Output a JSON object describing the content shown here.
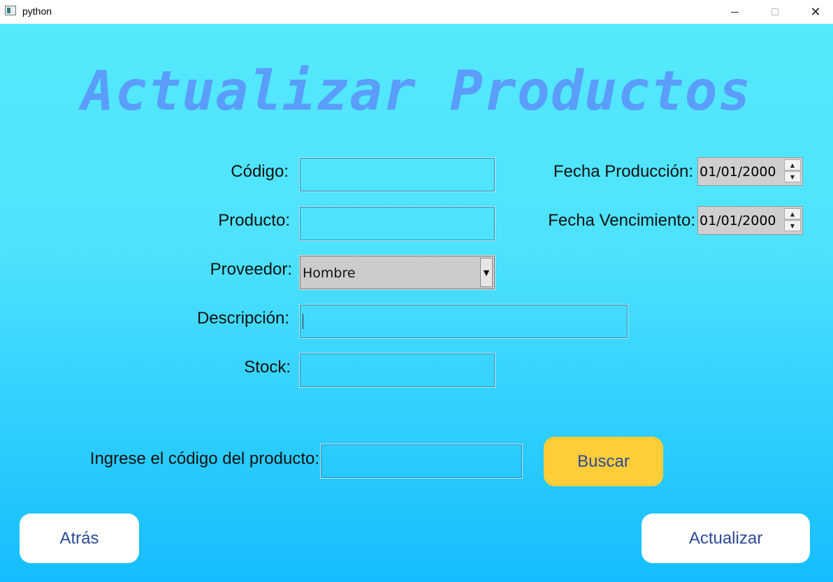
{
  "window": {
    "title": "python",
    "minimize_glyph": "",
    "maximize_glyph": "",
    "close_glyph": "✕"
  },
  "page": {
    "title": "Actualizar Productos"
  },
  "form": {
    "codigo_label": "Código:",
    "codigo_value": "",
    "producto_label": "Producto:",
    "producto_value": "",
    "proveedor_label": "Proveedor:",
    "proveedor_selected": "Hombre",
    "descripcion_label": "Descripción:",
    "descripcion_value": "",
    "stock_label": "Stock:",
    "stock_value": "",
    "fecha_produccion_label": "Fecha Producción:",
    "fecha_produccion_value": "01/01/2000",
    "fecha_vencimiento_label": "Fecha Vencimiento:",
    "fecha_vencimiento_value": "01/01/2000"
  },
  "search": {
    "label": "Ingrese el código del producto:",
    "value": "",
    "button_label": "Buscar"
  },
  "actions": {
    "back_label": "Atrás",
    "update_label": "Actualizar"
  },
  "glyphs": {
    "spin_up": "▲",
    "spin_down": "▼",
    "combo_arrow": "▼"
  },
  "colors": {
    "title": "#5a9dfb",
    "background_top": "#55e9fd",
    "background_bottom": "#14bdfd",
    "button_text": "#2c4a98",
    "search_button": "#ffcd38"
  }
}
